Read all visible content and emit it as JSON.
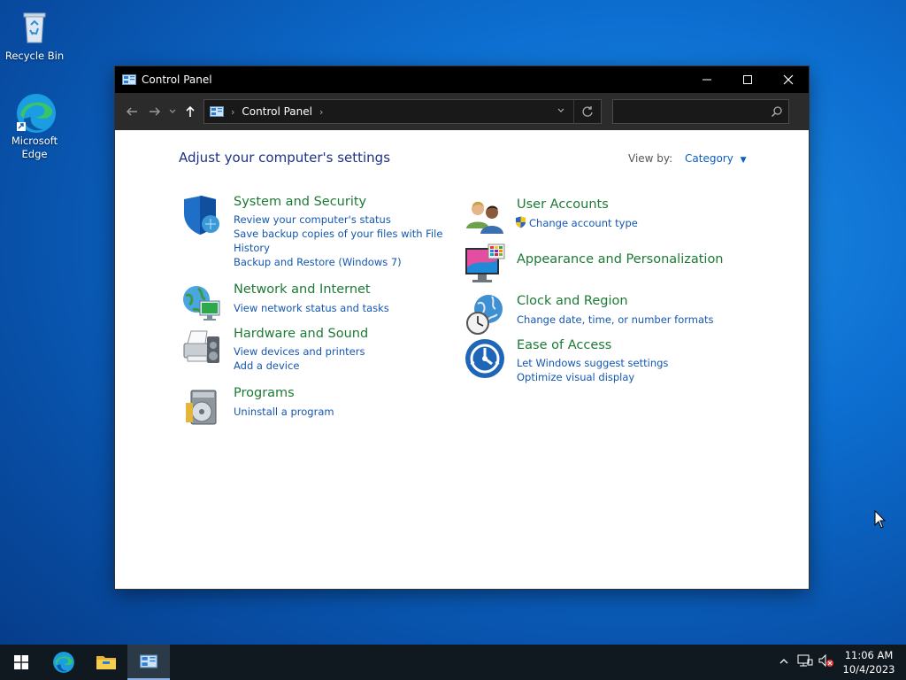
{
  "desktop": {
    "icons": [
      {
        "label": "Recycle Bin"
      },
      {
        "label": "Microsoft Edge"
      }
    ]
  },
  "window": {
    "title": "Control Panel",
    "address": {
      "crumb": "Control Panel"
    },
    "search": {
      "placeholder": ""
    }
  },
  "content": {
    "heading": "Adjust your computer's settings",
    "view_by_label": "View by:",
    "view_by_value": "Category",
    "categories": [
      {
        "title": "System and Security",
        "links": [
          "Review your computer's status",
          "Save backup copies of your files with File",
          "History",
          "Backup and Restore (Windows 7)"
        ]
      },
      {
        "title": "Network and Internet",
        "links": [
          "View network status and tasks"
        ]
      },
      {
        "title": "Hardware and Sound",
        "links": [
          "View devices and printers",
          "Add a device"
        ]
      },
      {
        "title": "Programs",
        "links": [
          "Uninstall a program"
        ]
      },
      {
        "title": "User Accounts",
        "links": [
          "Change account type"
        ]
      },
      {
        "title": "Appearance and Personalization",
        "links": []
      },
      {
        "title": "Clock and Region",
        "links": [
          "Change date, time, or number formats"
        ]
      },
      {
        "title": "Ease of Access",
        "links": [
          "Let Windows suggest settings",
          "Optimize visual display"
        ]
      }
    ]
  },
  "taskbar": {
    "clock_time": "11:06 AM",
    "clock_date": "10/4/2023"
  },
  "colors": {
    "link": "#1457b0",
    "category_title": "#1d7a35",
    "heading": "#1e3287",
    "titlebar": "#000000"
  }
}
